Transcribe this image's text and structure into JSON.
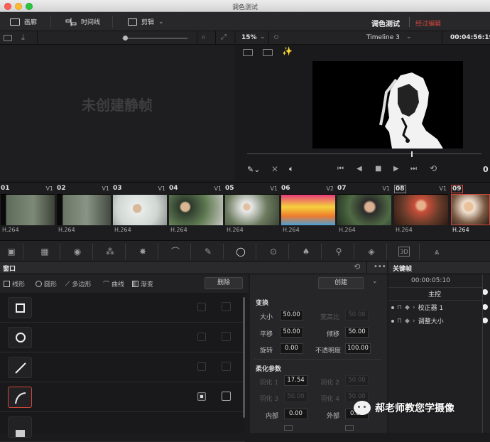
{
  "window": {
    "title": "调色测试"
  },
  "menu": {
    "gallery": "画廊",
    "timeline": "时间线",
    "edit": "剪辑",
    "project_name": "调色测试",
    "status": "经过编辑"
  },
  "gallery": {
    "empty_text": "未创建静帧"
  },
  "viewer": {
    "zoom": "15%",
    "timeline_name": "Timeline 3",
    "timecode": "00:04:56:19",
    "end_frame": "0"
  },
  "clips": [
    {
      "num": "01",
      "track": "V1",
      "codec": "H.264"
    },
    {
      "num": "02",
      "track": "V1",
      "codec": "H.264"
    },
    {
      "num": "03",
      "track": "V1",
      "codec": "H.264"
    },
    {
      "num": "04",
      "track": "V1",
      "codec": "H.264"
    },
    {
      "num": "05",
      "track": "V1",
      "codec": "H.264"
    },
    {
      "num": "06",
      "track": "V2",
      "codec": "H.264"
    },
    {
      "num": "07",
      "track": "V1",
      "codec": "H.264"
    },
    {
      "num": "08",
      "track": "V1",
      "codec": "H.264"
    },
    {
      "num": "09",
      "track": "",
      "codec": "H.264"
    }
  ],
  "window_panel": {
    "title": "窗口",
    "tools": {
      "linear": "线形",
      "circle": "圆形",
      "polygon": "多边形",
      "curve": "曲线",
      "gradient": "渐变"
    },
    "delete": "删除",
    "create": "创建"
  },
  "transform": {
    "title": "变换",
    "size_label": "大小",
    "size": "50.00",
    "aspect_label": "宽高比",
    "aspect": "50.00",
    "pan_label": "平移",
    "pan": "50.00",
    "tilt_label": "倾移",
    "tilt": "50.00",
    "rotate_label": "旋转",
    "rotate": "0.00",
    "opacity_label": "不透明度",
    "opacity": "100.00"
  },
  "softness": {
    "title": "柔化参数",
    "s1_label": "羽化 1",
    "s1": "17.54",
    "s2_label": "羽化 2",
    "s2": "50.00",
    "s3_label": "羽化 3",
    "s3": "50.00",
    "s4_label": "羽化 4",
    "s4": "50.00",
    "inside_label": "内部",
    "inside": "0.00",
    "outside_label": "外部",
    "outside": "0.00"
  },
  "keyframes": {
    "title": "关键帧",
    "timecode": "00:00:05:10",
    "master": "主控",
    "track1": "校正器 1",
    "track2": "调整大小"
  },
  "watermark": {
    "text": "郝老师教您学摄像"
  }
}
